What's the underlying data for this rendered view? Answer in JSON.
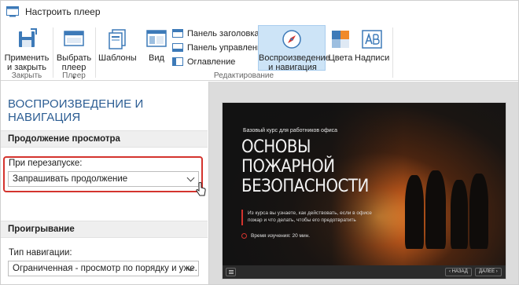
{
  "window": {
    "title": "Настроить плеер"
  },
  "ribbon": {
    "apply_close": "Применить и закрыть",
    "choose_player": "Выбрать плеер",
    "templates": "Шаблоны",
    "view": "Вид",
    "title_panel": "Панель заголовка",
    "control_panel": "Панель управления",
    "toc": "Оглавление",
    "playback_nav": "Воспроизведение и навигация",
    "colors": "Цвета",
    "captions": "Надписи",
    "groups": {
      "close": "Закрыть",
      "player": "Плеер",
      "edit": "Редактирование"
    }
  },
  "panel": {
    "title": "ВОСПРОИЗВЕДЕНИЕ И НАВИГАЦИЯ",
    "resume_section": "Продолжение просмотра",
    "on_restart_label": "При перезапуске:",
    "on_restart_value": "Запрашивать продолжение",
    "playback_section": "Проигрывание",
    "nav_type_label": "Тип навигации:",
    "nav_type_value": "Ограниченная - просмотр по порядку и уже..."
  },
  "slide": {
    "kicker": "Базовый курс для работников офиса",
    "headline": "ОСНОВЫ ПОЖАРНОЙ БЕЗОПАСНОСТИ",
    "description": "Из курса вы узнаете, как действовать, если в офисе пожар и что делать, чтобы его предотвратить",
    "time": "Время изучения: 20 мин.",
    "prev": "‹ НАЗАД",
    "next": "ДАЛЕЕ ›"
  },
  "colors": {
    "accent": "#2c5d93",
    "highlight": "#d4342e",
    "active_bg": "#cde4f7"
  }
}
